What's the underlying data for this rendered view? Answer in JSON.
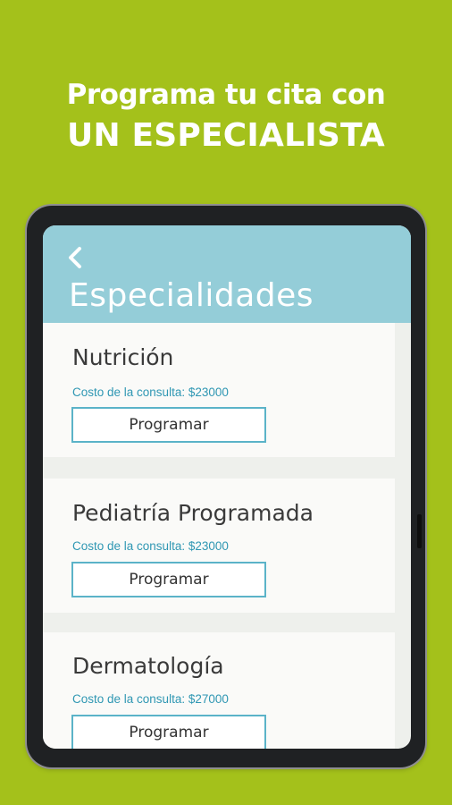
{
  "promo": {
    "line1": "Programa tu cita con",
    "line2": "UN ESPECIALISTA"
  },
  "appbar": {
    "back_icon": "chevron-left-icon",
    "title": "Especialidades"
  },
  "specialties": [
    {
      "name": "Nutrición",
      "cost": "Costo de la consulta: $23000",
      "button": "Programar"
    },
    {
      "name": "Pediatría Programada",
      "cost": "Costo de la consulta: $23000",
      "button": "Programar"
    },
    {
      "name": "Dermatología",
      "cost": "Costo de la consulta: $27000",
      "button": "Programar"
    }
  ],
  "colors": {
    "background": "#a4c11b",
    "appbar": "#94cdd8",
    "accent": "#2f97b3",
    "button_border": "#5bb3c8"
  }
}
